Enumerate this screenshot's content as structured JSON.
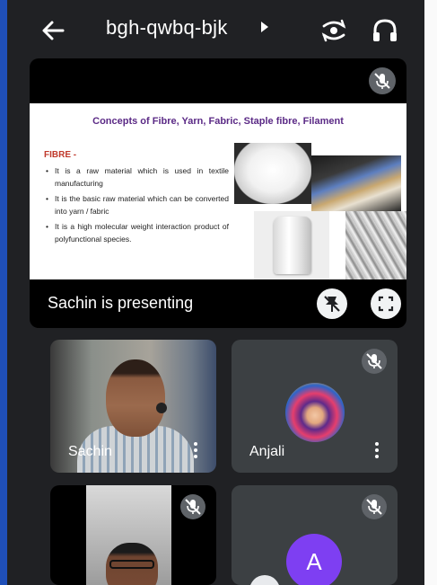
{
  "meeting": {
    "code": "bgh-qwbq-bjk"
  },
  "presentation": {
    "banner": "Sachin is presenting",
    "slide": {
      "title": "Concepts of Fibre, Yarn, Fabric, Staple fibre, Filament",
      "heading": "FIBRE -",
      "bullets": [
        "It is a raw material which is used in textile manufacturing",
        "It is the basic raw material which can be converted into yarn / fabric",
        "It is a high molecular weight interaction product of polyfunctional species."
      ]
    }
  },
  "participants": [
    {
      "name": "Sachin",
      "muted": false,
      "video": true
    },
    {
      "name": "Anjali",
      "muted": true,
      "video": false,
      "avatar": "profile-photo"
    },
    {
      "name": "",
      "muted": true,
      "video": true
    },
    {
      "name": "",
      "muted": true,
      "video": false,
      "initial": "A"
    }
  ],
  "colors": {
    "background": "#202124",
    "tile": "#3c4043",
    "avatar": "#7e3ff2",
    "slide_title": "#5b2a86",
    "slide_heading": "#c0392b"
  }
}
